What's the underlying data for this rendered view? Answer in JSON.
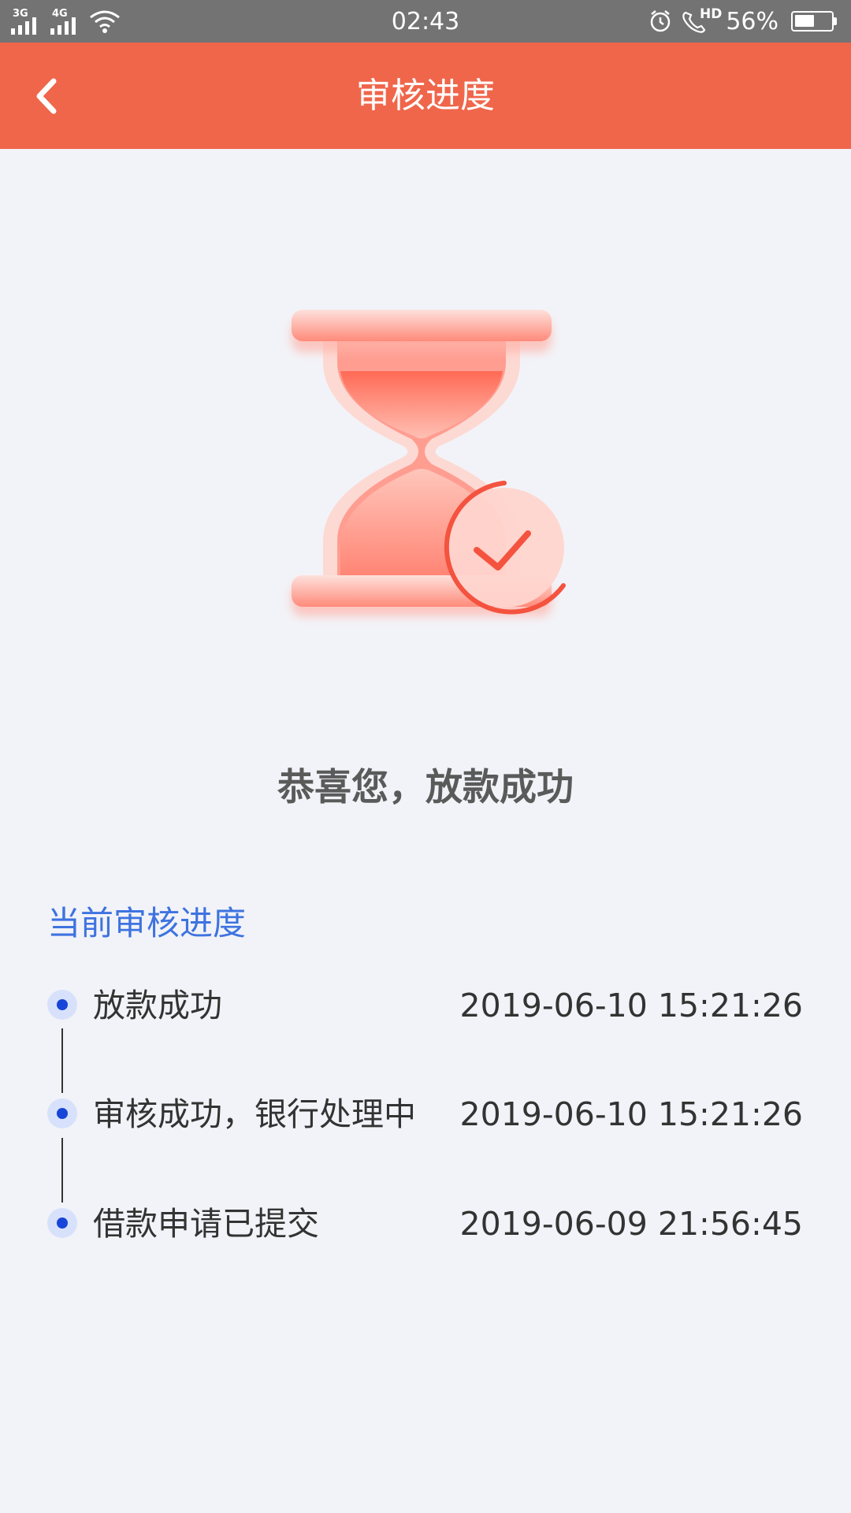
{
  "status_bar": {
    "signal_1": "3G",
    "signal_2": "4G",
    "time": "02:43",
    "hd_label": "HD",
    "battery": "56%",
    "battery_level": 0.56,
    "icons": [
      "wifi-icon",
      "alarm-icon",
      "call-hd-icon",
      "battery-icon"
    ]
  },
  "nav": {
    "title": "审核进度",
    "back_icon": "back-chevron-icon"
  },
  "hero": {
    "icon": "hourglass-check-icon"
  },
  "headline": "恭喜您，放款成功",
  "progress": {
    "section_title": "当前审核进度",
    "items": [
      {
        "label": "放款成功",
        "time": "2019-06-10 15:21:26"
      },
      {
        "label": "审核成功，银行处理中",
        "time": "2019-06-10 15:21:26"
      },
      {
        "label": "借款申请已提交",
        "time": "2019-06-09 21:56:45"
      }
    ]
  },
  "colors": {
    "accent": "#f0664b",
    "status_bar": "#737373",
    "background": "#f2f3f8",
    "link_blue": "#3e73e0",
    "dot_blue": "#1745d8"
  }
}
